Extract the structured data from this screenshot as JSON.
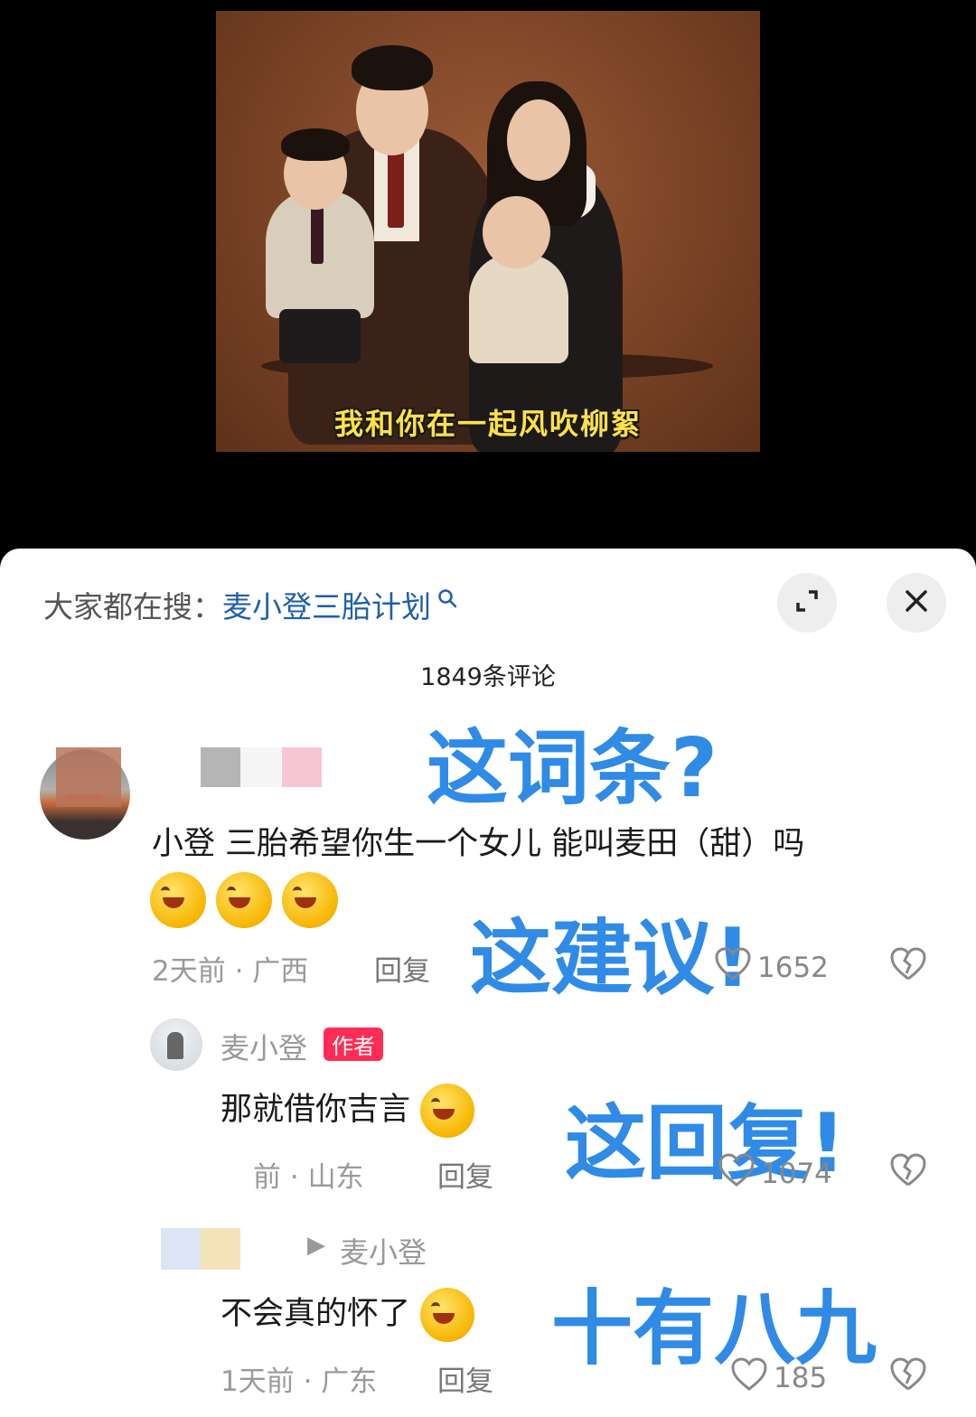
{
  "video": {
    "subtitle": "我和你在一起风吹柳絮"
  },
  "sheet": {
    "search_prefix": "大家都在搜：",
    "search_keyword": "麦小登三胎计划",
    "comment_count": "1849条评论",
    "expand_icon": "expand-icon",
    "close_icon": "close-icon"
  },
  "overlays": {
    "o1": "这词条?",
    "o2": "这建议!",
    "o3": "这回复!",
    "o4": "十有八九"
  },
  "comments": [
    {
      "text": "小登 三胎希望你生一个女儿 能叫麦田（甜）吗",
      "emojis": [
        "laughing-emoji",
        "laughing-emoji",
        "laughing-emoji"
      ],
      "time": "2天前",
      "location": "广西",
      "reply": "回复",
      "likes": "1652"
    }
  ],
  "replies": [
    {
      "author": "麦小登",
      "badge": "作者",
      "text": "那就借你吉言",
      "emoji": "crying-laughing-emoji",
      "time": "前",
      "location": "山东",
      "reply": "回复",
      "likes": "1074"
    },
    {
      "reply_to_arrow": "▶",
      "reply_to": "麦小登",
      "text": "不会真的怀了",
      "emoji": "crying-laughing-emoji",
      "time": "1天前",
      "location": "广东",
      "reply": "回复",
      "likes": "185"
    }
  ],
  "colors": {
    "accent": "#1f5fa8",
    "overlay_blue": "#2f8be6",
    "author_badge": "#ff2c55"
  }
}
